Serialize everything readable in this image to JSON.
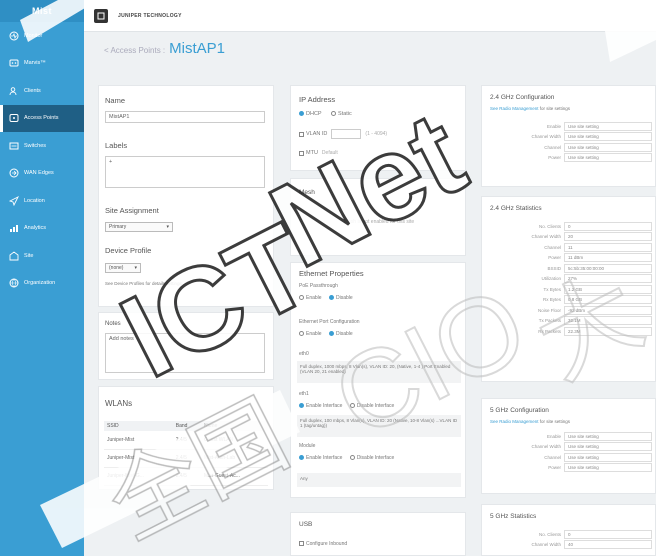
{
  "sidebar": {
    "logo": "Mist",
    "items": [
      {
        "label": "Monitor",
        "icon": "monitor-icon"
      },
      {
        "label": "Marvis™",
        "icon": "marvis-icon"
      },
      {
        "label": "Clients",
        "icon": "clients-icon"
      },
      {
        "label": "Access Points",
        "icon": "access-point-icon",
        "active": true
      },
      {
        "label": "Switches",
        "icon": "switch-icon"
      },
      {
        "label": "WAN Edges",
        "icon": "wan-edge-icon"
      },
      {
        "label": "Location",
        "icon": "location-icon"
      },
      {
        "label": "Analytics",
        "icon": "analytics-icon"
      },
      {
        "label": "Site",
        "icon": "site-icon"
      },
      {
        "label": "Organization",
        "icon": "organization-icon"
      }
    ]
  },
  "topbar": {
    "org_name": "JUNIPER TECHNOLOGY"
  },
  "breadcrumb": {
    "back": "< Access Points :",
    "title": "MistAP1"
  },
  "general": {
    "name_label": "Name",
    "name_value": "MistAP1",
    "labels_label": "Labels",
    "labels_add": "+",
    "site_assignment_label": "Site Assignment",
    "site_value": "Primary",
    "device_profile_label": "Device Profile",
    "device_profile_value": "(none)",
    "device_profile_note": "See Device Profiles for details settings"
  },
  "notes": {
    "label": "Notes",
    "placeholder": "Add notes"
  },
  "wlans": {
    "title": "WLANs",
    "columns": [
      "SSID",
      "Band",
      "Name"
    ],
    "rows": [
      {
        "ssid": "Juniper-Mist",
        "band": "2.4/5",
        "name": "Guest WLAN"
      },
      {
        "ssid": "Juniper-Mist",
        "band": "2.4/5",
        "name": "Mist-Auth-Lab"
      },
      {
        "ssid": "Juniper-Mist-G...",
        "band": "2.4/5",
        "name": "Mist-Guest-Ac..."
      }
    ]
  },
  "ip": {
    "title": "IP Address",
    "dhcp": "DHCP",
    "static": "Static",
    "vlan_label": "VLAN ID",
    "vlan_value": "",
    "vlan_hint": "(1 - 4094)",
    "mtu_label": "MTU",
    "mtu_hint": "Default"
  },
  "mesh": {
    "title": "Mesh",
    "message": "Mesh is not enabled for this site"
  },
  "ethernet": {
    "title": "Ethernet Properties",
    "poe_label": "PoE Passthrough",
    "poe_enable": "Enable",
    "poe_disable": "Disable",
    "port_config_label": "Ethernet Port Configuration",
    "port_enable": "Enable",
    "port_disable": "Disable",
    "eth0_label": "eth0",
    "eth0_text": "Full duplex, 1000 mbps, 8 Vlan(s), VLAN ID: 20, (Native, 1-4 ) Port Enabled (VLAN 20, 21 enabled)",
    "eth1_label": "eth1",
    "eth1_enable": "Enable Interface",
    "eth1_disable": "Disable Interface",
    "eth1_text": "Full duplex, 100 mbps, 8 Vlan(s), VLAN ID: 20 (Native, 10-8 Vlan(s) ...VLAN ID 1 (tag/untag))",
    "module_label": "Module",
    "module_enable": "Enable Interface",
    "module_disable": "Disable Interface",
    "module_value": "Any"
  },
  "usb": {
    "title": "USB",
    "option": "Configure Inbound"
  },
  "band24_config": {
    "title": "2.4 GHz Configuration",
    "note_link": "See Radio Management",
    "note_rest": "for site settings",
    "rows": [
      {
        "k": "Enable",
        "v": "Use site setting"
      },
      {
        "k": "Channel Width",
        "v": "Use site setting"
      },
      {
        "k": "Channel",
        "v": "Use site setting"
      },
      {
        "k": "Power",
        "v": "Use site setting"
      }
    ]
  },
  "band24_stats": {
    "title": "2.4 GHz Statistics",
    "rows": [
      {
        "k": "No. Clients",
        "v": "0"
      },
      {
        "k": "Channel Width",
        "v": "20"
      },
      {
        "k": "Channel",
        "v": "11"
      },
      {
        "k": "Power",
        "v": "11 dBm"
      },
      {
        "k": "BSSID",
        "v": "5c:5b:35:00:00:00"
      },
      {
        "k": "Utilization",
        "v": "27%"
      },
      {
        "k": "Tx Bytes",
        "v": "1.2 GB"
      },
      {
        "k": "Rx Bytes",
        "v": "0.8 GB"
      },
      {
        "k": "Noise Floor",
        "v": "-92 dBm"
      },
      {
        "k": "Tx Packets",
        "v": "32.1M"
      },
      {
        "k": "Rx Packets",
        "v": "22.3M"
      }
    ]
  },
  "band5_config": {
    "title": "5 GHz Configuration",
    "note_link": "See Radio Management",
    "note_rest": "for site settings",
    "rows": [
      {
        "k": "Enable",
        "v": "Use site setting"
      },
      {
        "k": "Channel Width",
        "v": "Use site setting"
      },
      {
        "k": "Channel",
        "v": "Use site setting"
      },
      {
        "k": "Power",
        "v": "Use site setting"
      }
    ]
  },
  "band5_stats": {
    "title": "5 GHz Statistics",
    "rows": [
      {
        "k": "No. Clients",
        "v": "0"
      },
      {
        "k": "Channel Width",
        "v": "40"
      }
    ]
  },
  "watermark": {
    "text1": "ICT",
    "text2": "Net",
    "text3": "全国",
    "text4": "CIO",
    "text5": "大"
  },
  "colors": {
    "accent": "#3a9ed3",
    "sidebar": "#3a9ed3",
    "sidebar_active": "#1f5f85"
  }
}
